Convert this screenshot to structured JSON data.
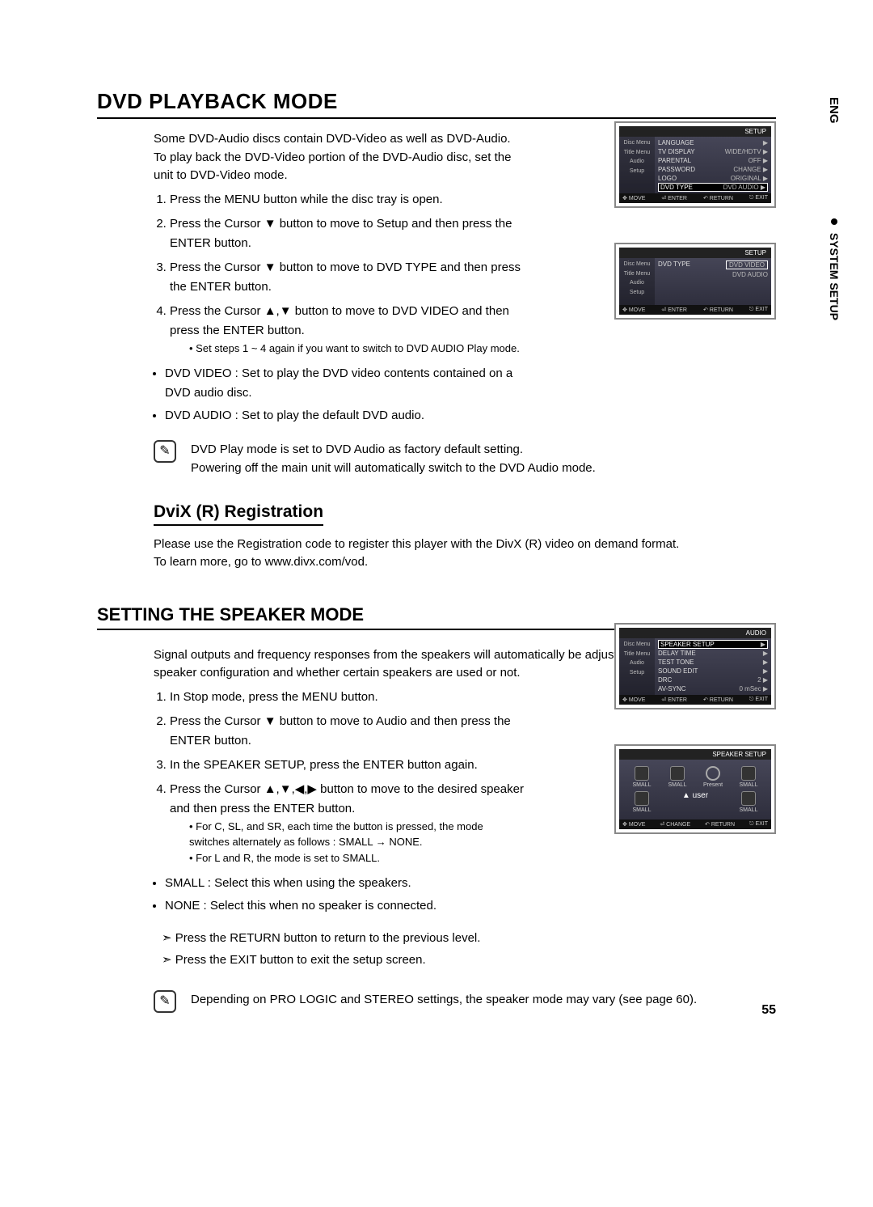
{
  "page_number": "55",
  "side": {
    "eng": "ENG",
    "section": "SYSTEM SETUP"
  },
  "dvd": {
    "title": "DVD PLAYBACK MODE",
    "intro1": "Some DVD-Audio discs contain DVD-Video as well as DVD-Audio.",
    "intro2": "To play back the DVD-Video portion of the DVD-Audio disc, set the unit to DVD-Video mode.",
    "steps": [
      "Press the MENU button while the disc tray is open.",
      "Press the Cursor ▼ button to move to Setup and then press the ENTER button.",
      "Press the Cursor ▼ button to move to DVD TYPE and then press the ENTER button.",
      "Press the Cursor ▲,▼ button to move to DVD VIDEO and then press the ENTER button."
    ],
    "substep": "Set steps 1 ~ 4 again if you want to switch to DVD AUDIO Play mode.",
    "bullets": [
      "DVD VIDEO : Set to play the DVD video contents contained on a DVD audio disc.",
      "DVD AUDIO : Set to play the default DVD audio."
    ],
    "note1": "DVD Play mode is set to DVD Audio as factory default setting.",
    "note2": "Powering off the main unit will automatically switch to the DVD Audio mode."
  },
  "divx": {
    "title": "DviX (R) Registration",
    "p1": "Please use the Registration code to register this player with the DivX (R) video on demand format.",
    "p2": "To learn more, go to www.divx.com/vod."
  },
  "speaker": {
    "title": "SETTING THE SPEAKER MODE",
    "intro": "Signal outputs and frequency responses from the speakers will automatically be adjusted according to your speaker configuration and whether certain speakers are used or not.",
    "steps": [
      "In Stop mode, press the MENU button.",
      "Press the Cursor ▼ button to move to Audio and then press the ENTER button.",
      "In the SPEAKER SETUP, press the ENTER button again.",
      "Press the Cursor ▲,▼,◀,▶ button to move to the desired speaker and then press the ENTER button."
    ],
    "sub1": "For C, SL, and SR, each time the button is pressed, the mode switches alternately as follows : SMALL → NONE.",
    "sub2": "For L and R, the mode is set to SMALL.",
    "bullets": [
      "SMALL : Select this when using the speakers.",
      "NONE : Select this when no speaker is connected."
    ],
    "ret": "Press the RETURN button to return to the previous level.",
    "exit": "Press the EXIT button to exit the setup screen.",
    "note": "Depending on PRO LOGIC and STEREO settings, the speaker mode may vary (see page 60)."
  },
  "osd": {
    "footer": {
      "move": "MOVE",
      "enter": "ENTER",
      "return": "RETURN",
      "exit": "EXIT",
      "change": "CHANGE"
    },
    "side_labels": {
      "disc": "Disc Menu",
      "title": "Title Menu",
      "audio": "Audio",
      "setup": "Setup"
    },
    "screen1": {
      "header_l": "",
      "header_r": "SETUP",
      "rows": [
        {
          "k": "LANGUAGE",
          "v": "▶"
        },
        {
          "k": "TV DISPLAY",
          "v": "WIDE/HDTV ▶"
        },
        {
          "k": "PARENTAL",
          "v": "OFF ▶"
        },
        {
          "k": "PASSWORD",
          "v": "CHANGE ▶"
        },
        {
          "k": "LOGO",
          "v": "ORIGINAL ▶"
        },
        {
          "k": "DVD TYPE",
          "v": "DVD AUDIO ▶",
          "hl": true
        }
      ]
    },
    "screen2": {
      "header_l": "",
      "header_r": "SETUP",
      "rows": [
        {
          "k": "DVD TYPE",
          "v": "DVD VIDEO",
          "hl": true
        },
        {
          "k": "",
          "v": "DVD AUDIO"
        }
      ]
    },
    "screen3": {
      "header_l": "",
      "header_r": "AUDIO",
      "rows": [
        {
          "k": "SPEAKER SETUP",
          "v": "▶",
          "hl": true
        },
        {
          "k": "DELAY TIME",
          "v": "▶"
        },
        {
          "k": "TEST TONE",
          "v": "▶"
        },
        {
          "k": "SOUND EDIT",
          "v": "▶"
        },
        {
          "k": "DRC",
          "v": "2 ▶"
        },
        {
          "k": "AV-SYNC",
          "v": "0 mSec ▶"
        }
      ]
    },
    "screen4": {
      "header": "SPEAKER SETUP",
      "labels": {
        "small": "SMALL",
        "present": "Present",
        "user": "▲ user"
      }
    }
  }
}
